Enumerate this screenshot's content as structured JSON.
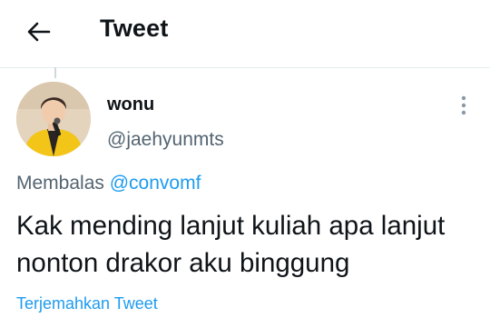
{
  "header": {
    "title": "Tweet",
    "back_icon": "arrow-left-icon"
  },
  "tweet": {
    "author_name": "wonu",
    "author_handle": "@jaehyunmts",
    "avatar_icon": "profile-photo",
    "more_icon": "more-vertical-icon",
    "reply_prefix": "Membalas",
    "reply_to": "@convomf",
    "text": "Kak mending lanjut kuliah apa lanjut nonton drakor aku binggung",
    "translate_label": "Terjemahkan Tweet"
  },
  "colors": {
    "text": "#0f1419",
    "secondary": "#536471",
    "accent": "#1d9bf0",
    "divider": "#e6ecf0"
  }
}
